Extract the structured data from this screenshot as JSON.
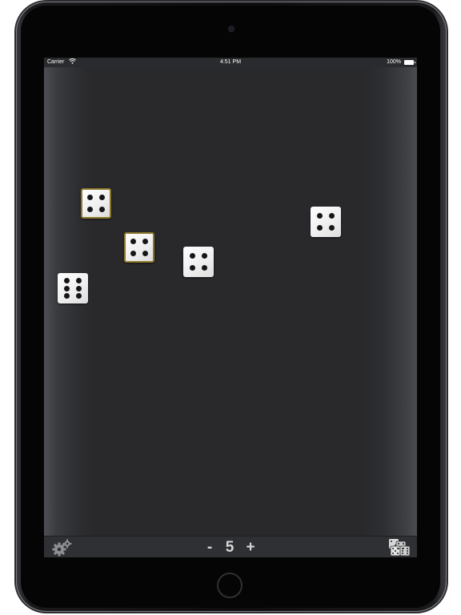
{
  "status_bar": {
    "carrier": "Carrier",
    "time": "4:51 PM",
    "battery": "100%"
  },
  "dice": [
    {
      "value": 4,
      "held": true
    },
    {
      "value": 4,
      "held": true
    },
    {
      "value": 4,
      "held": false
    },
    {
      "value": 6,
      "held": false
    },
    {
      "value": 4,
      "held": false
    }
  ],
  "toolbar": {
    "settings_icon": "gear-icon",
    "decrease_label": "-",
    "dice_count": "5",
    "increase_label": "+",
    "roll_icon": "dice-stack-icon"
  },
  "colors": {
    "table": "#29292c",
    "held_outline": "#8c7a2a",
    "pip": "#161616"
  }
}
